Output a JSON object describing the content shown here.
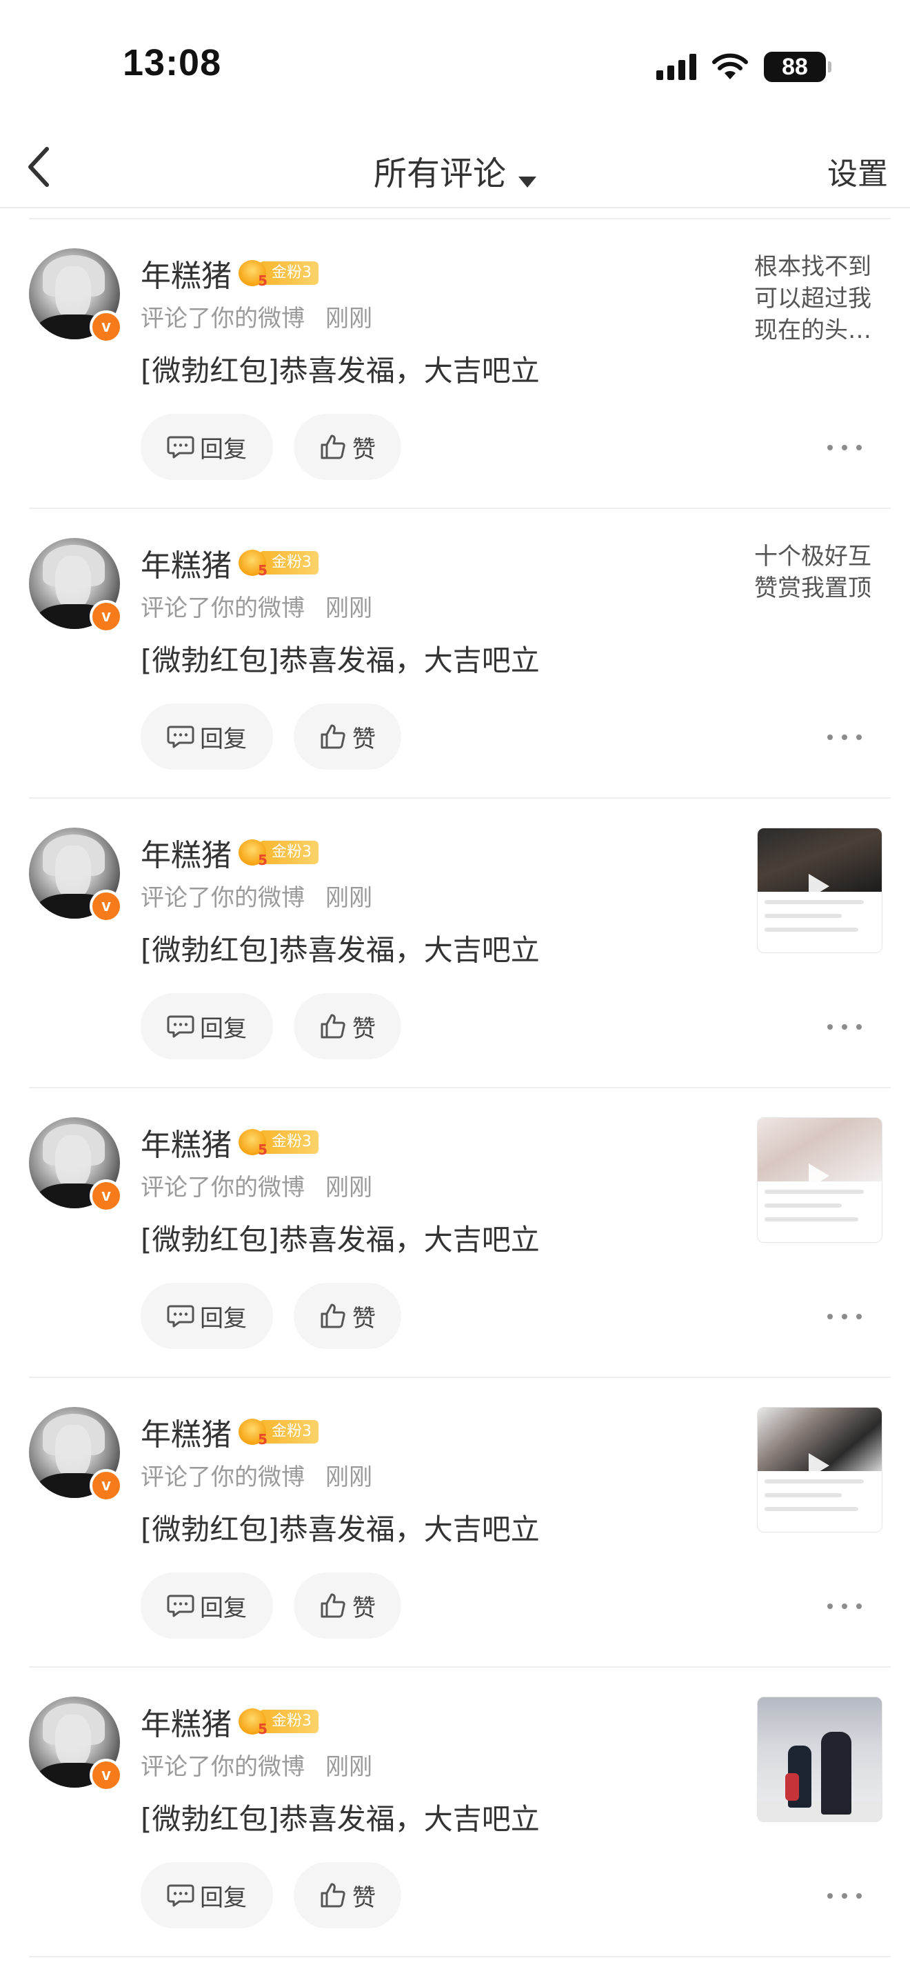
{
  "status_bar": {
    "time": "13:08",
    "battery": "88"
  },
  "nav": {
    "title": "所有评论",
    "settings_label": "设置",
    "back_icon": "chevron-left-icon",
    "dropdown_icon": "caret-down-icon"
  },
  "colors": {
    "verified_badge": "#f77b1b",
    "fan_badge": "#f8b52c",
    "muted_text": "#9a9a9a",
    "button_bg": "#f5f5f5"
  },
  "items": [
    {
      "username": "年糕猪",
      "fan_badge_level": "5",
      "fan_badge_label": "金粉3",
      "action": "评论了你的微博",
      "time": "刚刚",
      "comment": "[微勃红包]恭喜发福，大吉吧立",
      "reply_label": "回复",
      "like_label": "赞",
      "quote": "根本找不到可以超过我现在的头…"
    },
    {
      "username": "年糕猪",
      "fan_badge_level": "5",
      "fan_badge_label": "金粉3",
      "action": "评论了你的微博",
      "time": "刚刚",
      "comment": "[微勃红包]恭喜发福，大吉吧立",
      "reply_label": "回复",
      "like_label": "赞",
      "quote": "十个极好互赞赏我置顶"
    },
    {
      "username": "年糕猪",
      "fan_badge_level": "5",
      "fan_badge_label": "金粉3",
      "action": "评论了你的微博",
      "time": "刚刚",
      "comment": "[微勃红包]恭喜发福，大吉吧立",
      "reply_label": "回复",
      "like_label": "赞"
    },
    {
      "username": "年糕猪",
      "fan_badge_level": "5",
      "fan_badge_label": "金粉3",
      "action": "评论了你的微博",
      "time": "刚刚",
      "comment": "[微勃红包]恭喜发福，大吉吧立",
      "reply_label": "回复",
      "like_label": "赞"
    },
    {
      "username": "年糕猪",
      "fan_badge_level": "5",
      "fan_badge_label": "金粉3",
      "action": "评论了你的微博",
      "time": "刚刚",
      "comment": "[微勃红包]恭喜发福，大吉吧立",
      "reply_label": "回复",
      "like_label": "赞"
    },
    {
      "username": "年糕猪",
      "fan_badge_level": "5",
      "fan_badge_label": "金粉3",
      "action": "评论了你的微博",
      "time": "刚刚",
      "comment": "[微勃红包]恭喜发福，大吉吧立",
      "reply_label": "回复",
      "like_label": "赞"
    }
  ]
}
